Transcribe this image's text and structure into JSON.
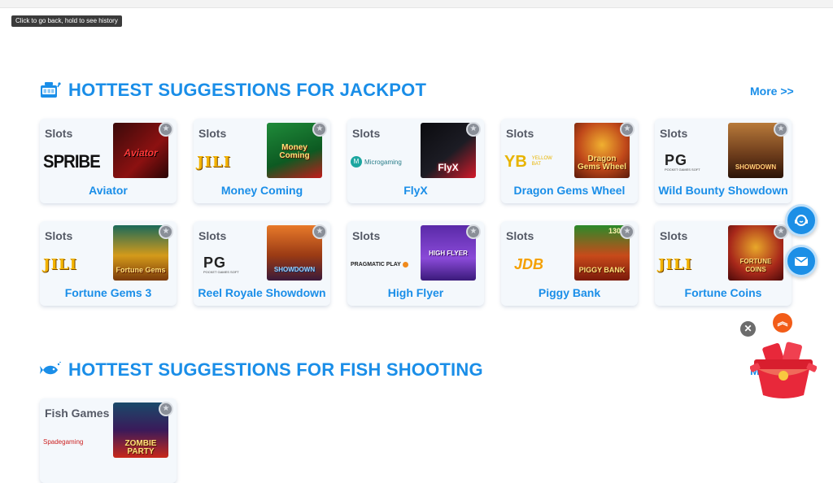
{
  "browser": {
    "back_tooltip": "Click to go back, hold to see history"
  },
  "jackpot_section": {
    "title": "HOTTEST SUGGESTIONS FOR JACKPOT",
    "icon": "slot-machine-icon",
    "more_label": "More >>",
    "games": [
      {
        "category": "Slots",
        "provider": "SPRIBE",
        "name": "Aviator",
        "thumb_text": "Aviator"
      },
      {
        "category": "Slots",
        "provider": "JILI",
        "name": "Money Coming",
        "thumb_text": "Money Coming"
      },
      {
        "category": "Slots",
        "provider": "Microgaming",
        "name": "FlyX",
        "thumb_text": "FlyX"
      },
      {
        "category": "Slots",
        "provider": "YELLOW BAT",
        "name": "Dragon Gems Wheel",
        "thumb_text": "Dragon Gems Wheel"
      },
      {
        "category": "Slots",
        "provider": "PG",
        "name": "Wild Bounty Showdown",
        "thumb_text": "SHOWDOWN"
      },
      {
        "category": "Slots",
        "provider": "JILI",
        "name": "Fortune Gems 3",
        "thumb_text": "Fortune Gems"
      },
      {
        "category": "Slots",
        "provider": "PG",
        "name": "Reel Royale Showdown",
        "thumb_text": "SHOWDOWN"
      },
      {
        "category": "Slots",
        "provider": "PRAGMATIC PLAY",
        "name": "High Flyer",
        "thumb_text": "HIGH FLYER"
      },
      {
        "category": "Slots",
        "provider": "JDB",
        "name": "Piggy Bank",
        "thumb_text": "PIGGY BANK",
        "thumb_num": "1300"
      },
      {
        "category": "Slots",
        "provider": "JILI",
        "name": "Fortune Coins",
        "thumb_text": "FORTUNE COINS"
      }
    ]
  },
  "fish_section": {
    "title": "HOTTEST SUGGESTIONS FOR FISH SHOOTING",
    "icon": "fish-icon",
    "games": [
      {
        "category": "Fish Games",
        "provider": "Spadegaming",
        "thumb_text": "ZOMBIE PARTY"
      }
    ]
  },
  "provider_marks": {
    "pg_sub": "POCKET GAMES SOFT",
    "yb_mark": "YB",
    "ybat_line1": "YELLOW",
    "ybat_line2": "BAT",
    "micro_mark": "M"
  },
  "floating": {
    "close_symbol": "✕",
    "up_symbol": "︽",
    "fav_symbol": "★"
  },
  "colors": {
    "accent": "#1a8ee8",
    "card_bg": "#f4f8fc",
    "float_button": "#1c8fe6",
    "scroll_top": "#f25c18"
  }
}
